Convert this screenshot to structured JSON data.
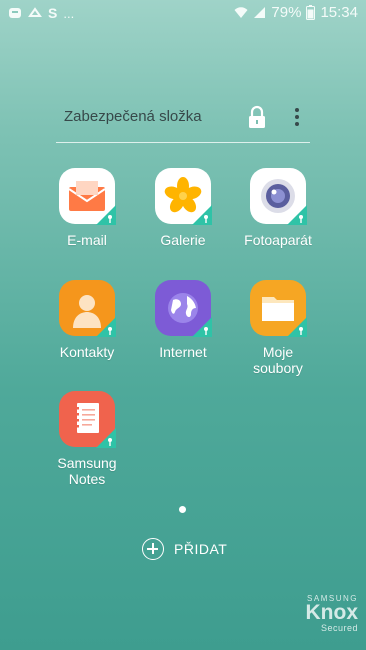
{
  "status_bar": {
    "left_text": "...",
    "battery": "79%",
    "time": "15:34"
  },
  "folder": {
    "title": "Zabezpečená složka"
  },
  "apps": [
    {
      "label": "E-mail",
      "icon": "email-icon",
      "color": "#ff7a45"
    },
    {
      "label": "Galerie",
      "icon": "gallery-flower-icon",
      "color": "#ffb400"
    },
    {
      "label": "Fotoaparát",
      "icon": "camera-lens-icon",
      "color": "#5a5e9e"
    },
    {
      "label": "Kontakty",
      "icon": "contacts-person-icon",
      "color": "#f5961c"
    },
    {
      "label": "Internet",
      "icon": "internet-globe-icon",
      "color": "#7d5bd6"
    },
    {
      "label": "Moje soubory",
      "icon": "folder-icon",
      "color": "#f6a623"
    },
    {
      "label": "Samsung Notes",
      "icon": "notes-icon",
      "color": "#f0634d"
    }
  ],
  "add_button": {
    "label": "PŘIDAT"
  },
  "knox": {
    "brand": "SAMSUNG",
    "name": "Knox",
    "sub": "Secured"
  }
}
